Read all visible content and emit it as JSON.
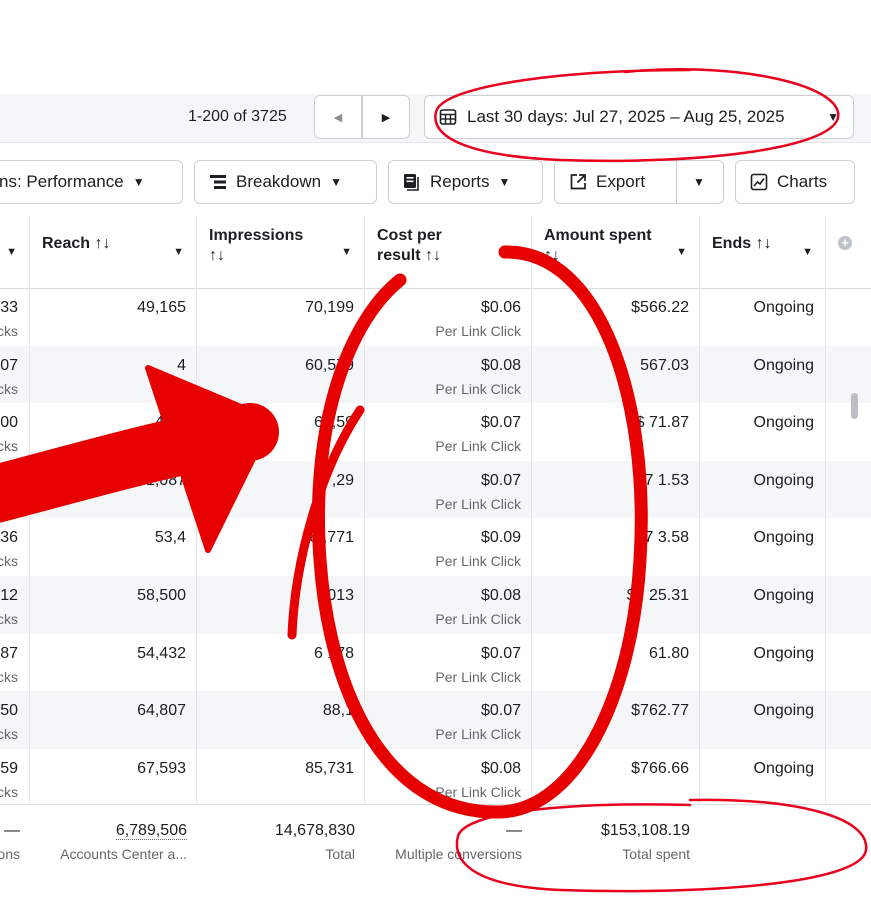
{
  "pagination": {
    "range": "1-200 of 3725"
  },
  "date_range": {
    "label": "Last 30 days: Jul 27, 2025 – Aug 25, 2025"
  },
  "toolbar": {
    "columns_label": "ns: Performance",
    "breakdown_label": "Breakdown",
    "reports_label": "Reports",
    "export_label": "Export",
    "charts_label": "Charts"
  },
  "headers": {
    "reach": "Reach ↑↓",
    "impressions_1": "Impressions",
    "impressions_2": "↑↓",
    "cost_1": "Cost per",
    "cost_2": "result ↑↓",
    "amount_1": "Amount spent",
    "amount_2": "↑↓",
    "ends": "Ends ↑↓",
    "cost_sub": "Per Link Click"
  },
  "left_sub": "cks",
  "rows": [
    {
      "left": "33",
      "reach": "49,165",
      "impressions": "70,199",
      "cost": "$0.06",
      "cost_sub": "Per Link Click",
      "amount": "$566.22",
      "ends": "Ongoing"
    },
    {
      "left": "07",
      "reach": "4",
      "impressions": "60,579",
      "cost": "$0.08",
      "cost_sub": "Per Link Click",
      "amount": "567.03",
      "ends": "Ongoing"
    },
    {
      "left": "00",
      "reach": "48,5",
      "impressions": "64,59",
      "cost": "$0.07",
      "cost_sub": "Per Link Click",
      "amount": "$ 71.87",
      "ends": "Ongoing"
    },
    {
      "left": "",
      "reach": "51,087",
      "impressions": "8 ,29",
      "cost": "$0.07",
      "cost_sub": "Per Link Click",
      "amount": "$7 1.53",
      "ends": "Ongoing"
    },
    {
      "left": "36",
      "reach": "53,4",
      "impressions": "8 ,771",
      "cost": "$0.09",
      "cost_sub": "Per Link Click",
      "amount": "$7 3.58",
      "ends": "Ongoing"
    },
    {
      "left": "12",
      "reach": "58,500",
      "impressions": ",013",
      "cost": "$0.08",
      "cost_sub": "Per Link Click",
      "amount": "$7 25.31",
      "ends": "Ongoing"
    },
    {
      "left": "87",
      "reach": "54,432",
      "impressions": "6 178",
      "cost": "$0.07",
      "cost_sub": "Per Link Click",
      "amount": "61.80",
      "ends": "Ongoing"
    },
    {
      "left": "50",
      "reach": "64,807",
      "impressions": "88,1",
      "cost": "$0.07",
      "cost_sub": "Per Link Click",
      "amount": "$762.77",
      "ends": "Ongoing"
    },
    {
      "left": "59",
      "reach": "67,593",
      "impressions": "85,731",
      "cost": "$0.08",
      "cost_sub": "Per Link Click",
      "amount": "$766.66",
      "ends": "Ongoing"
    }
  ],
  "totals": {
    "left_value": "—",
    "left_label": "ons",
    "reach": "6,789,506",
    "reach_label": "Accounts Center a...",
    "impressions": "14,678,830",
    "impressions_label": "Total",
    "cost": "—",
    "cost_label": "Multiple conversions",
    "amount": "$153,108.19",
    "amount_label": "Total spent"
  },
  "colors": {
    "annotation": "#e8001c",
    "arrow": "#e60000"
  }
}
